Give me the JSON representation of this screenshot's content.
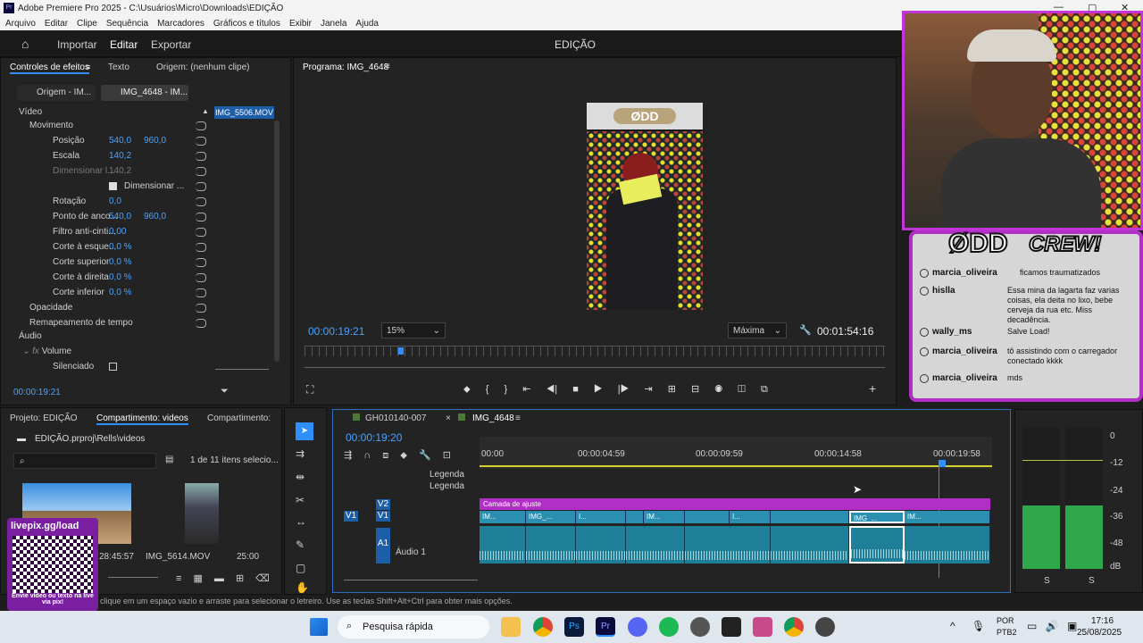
{
  "window": {
    "title": "Adobe Premiere Pro 2025 - C:\\Usuários\\Micro\\Downloads\\EDIÇÃO"
  },
  "menu": [
    "Arquivo",
    "Editar",
    "Clipe",
    "Sequência",
    "Marcadores",
    "Gráficos e títulos",
    "Exibir",
    "Janela",
    "Ajuda"
  ],
  "workspace": {
    "tabs": [
      "Importar",
      "Editar",
      "Exportar"
    ],
    "title": "EDIÇÃO"
  },
  "effects": {
    "tabs": [
      "Controles de efeitos",
      "Texto",
      "Origem: (nenhum clipe)"
    ],
    "source_tab": "Origem - IM...",
    "seq_tab": "IMG_4648 - IM...",
    "clip_label": "IMG_5506.MOV",
    "video_header": "Vídeo",
    "props": [
      {
        "name": "Movimento",
        "v1": "",
        "v2": ""
      },
      {
        "name": "Posição",
        "v1": "540,0",
        "v2": "960,0"
      },
      {
        "name": "Escala",
        "v1": "140,2",
        "v2": ""
      },
      {
        "name": "Dimensionar l...",
        "v1": "140,2",
        "v2": ""
      },
      {
        "name": "Dimensionar ...",
        "v1": "",
        "v2": ""
      },
      {
        "name": "Rotação",
        "v1": "0,0",
        "v2": ""
      },
      {
        "name": "Ponto de anco...",
        "v1": "540,0",
        "v2": "960,0"
      },
      {
        "name": "Filtro anti-cinti...",
        "v1": "0,00",
        "v2": ""
      },
      {
        "name": "Corte à esque...",
        "v1": "0,0 %",
        "v2": ""
      },
      {
        "name": "Corte superior",
        "v1": "0,0 %",
        "v2": ""
      },
      {
        "name": "Corte à direita",
        "v1": "0,0 %",
        "v2": ""
      },
      {
        "name": "Corte inferior",
        "v1": "0,0 %",
        "v2": ""
      },
      {
        "name": "Opacidade",
        "v1": "",
        "v2": ""
      },
      {
        "name": "Remapeamento de tempo",
        "v1": "",
        "v2": ""
      }
    ],
    "audio_header": "Áudio",
    "audio_props": [
      "Volume",
      "Silenciado"
    ],
    "timecode": "00:00:19:21"
  },
  "program": {
    "title": "Programa: IMG_4648",
    "timecode": "00:00:19:21",
    "zoom": "15%",
    "quality": "Máxima",
    "duration": "00:01:54:16",
    "logo": "ØDD"
  },
  "project": {
    "tabs": [
      "Projeto: EDIÇÃO",
      "Compartimento: videos",
      "Compartimento:"
    ],
    "path": "EDIÇÃO.prproj\\Rells\\videos",
    "count": "1 de 11 itens selecio...",
    "items": [
      {
        "name": "",
        "duration": "28:45:57"
      },
      {
        "name": "IMG_5614.MOV",
        "duration": "25:00"
      }
    ]
  },
  "timeline": {
    "tabs": [
      "GH010140-007",
      "IMG_4648"
    ],
    "timecode": "00:00:19:20",
    "ruler": [
      "00:00",
      "00:00:04:59",
      "00:00:09:59",
      "00:00:14:58",
      "00:00:19:58"
    ],
    "tracks": {
      "captions": [
        "Legenda",
        "Legenda"
      ],
      "v2": "V2",
      "v1": "V1",
      "a1": "A1",
      "audio_label": "Áudio 1"
    },
    "adjustment": "Camada de ajuste",
    "clips": [
      "IM...",
      "IMG_...",
      "I...",
      "IM...",
      "I...",
      "IMG_...",
      "IM..."
    ],
    "meter": [
      "0",
      "-12",
      "-24",
      "-36",
      "-48",
      "dB"
    ],
    "meter_foot": [
      "S",
      "S"
    ]
  },
  "status": "clique em um espaço vazio e arraste para selecionar o letreiro. Use as teclas Shift+Alt+Ctrl para obter mais opções.",
  "overlay": {
    "brand": "ØDD",
    "brand_suffix": "CREW!",
    "livepix": "livepix.gg/load",
    "livepix_note": "Envie vídeo ou texto na live via pix!",
    "chat": [
      {
        "user": "marcia_oliveira",
        "msg": "ficamos traumatizados"
      },
      {
        "user": "hislla",
        "msg": "Essa mina da lagarta faz varias coisas, ela deita no lixo, bebe cerveja da rua etc. Miss decadência."
      },
      {
        "user": "wally_ms",
        "msg": "Salve Load!"
      },
      {
        "user": "marcia_oliveira",
        "msg": "tô assistindo com o carregador conectado kkkk"
      },
      {
        "user": "marcia_oliveira",
        "msg": "mds"
      }
    ]
  },
  "taskbar": {
    "search": "Pesquisa rápida",
    "lang": "POR",
    "layout": "PTB2",
    "time": "17:16",
    "date": "25/08/2025"
  },
  "colors": {
    "accent": "#2f8fff",
    "clip": "#2a8fb0",
    "adjust": "#b12ec7",
    "overlay_border": "#c435d9"
  }
}
